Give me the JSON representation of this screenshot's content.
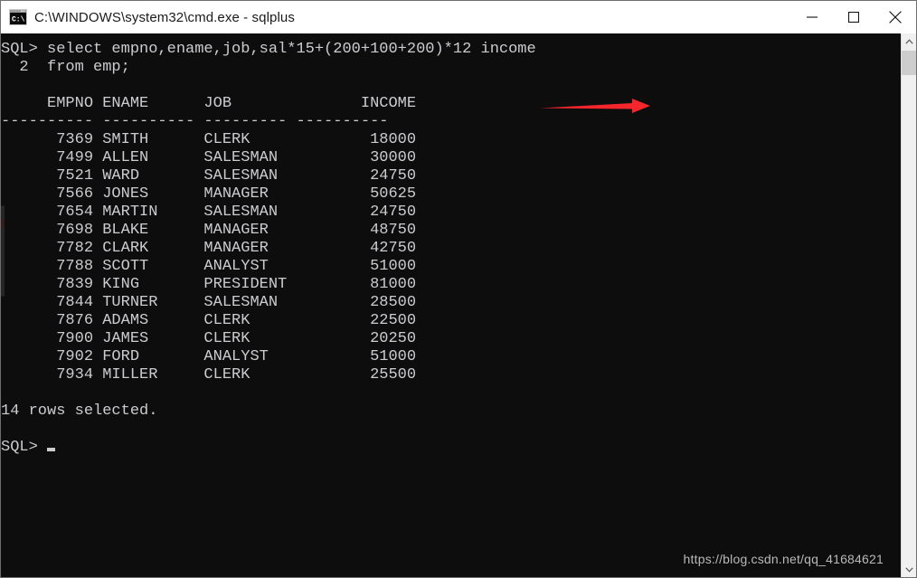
{
  "window": {
    "title": "C:\\WINDOWS\\system32\\cmd.exe - sqlplus",
    "icon": "cmd-console-icon",
    "background_color": "#0d0d0d",
    "text_color": "#ccccd0",
    "titlebar_color": "#ffffff",
    "controls": {
      "minimize_label": "Minimize",
      "maximize_label": "Maximize",
      "close_label": "Close"
    }
  },
  "terminal": {
    "prompt": "SQL>",
    "continuation_prompt": "  2",
    "query_line_1": "SQL> select empno,ename,job,sal*15+(200+100+200)*12 income",
    "query_line_2": "  2  from emp;",
    "header_line": "     EMPNO ENAME      JOB              INCOME",
    "separator_line": "---------- ---------- --------- ----------",
    "rows_text": [
      "      7369 SMITH      CLERK             18000",
      "      7499 ALLEN      SALESMAN          30000",
      "      7521 WARD       SALESMAN          24750",
      "      7566 JONES      MANAGER           50625",
      "      7654 MARTIN     SALESMAN          24750",
      "      7698 BLAKE      MANAGER           48750",
      "      7782 CLARK      MANAGER           42750",
      "      7788 SCOTT      ANALYST           51000",
      "      7839 KING       PRESIDENT         81000",
      "      7844 TURNER     SALESMAN          28500",
      "      7876 ADAMS      CLERK             22500",
      "      7900 JAMES      CLERK             20250",
      "      7902 FORD       ANALYST           51000",
      "      7934 MILLER     CLERK             25500"
    ],
    "status_line": "14 rows selected.",
    "final_prompt": "SQL>",
    "cursor": "block-cursor"
  },
  "result_table": {
    "columns": [
      "EMPNO",
      "ENAME",
      "JOB",
      "INCOME"
    ],
    "rows": [
      {
        "EMPNO": "7369",
        "ENAME": "SMITH",
        "JOB": "CLERK",
        "INCOME": "18000"
      },
      {
        "EMPNO": "7499",
        "ENAME": "ALLEN",
        "JOB": "SALESMAN",
        "INCOME": "30000"
      },
      {
        "EMPNO": "7521",
        "ENAME": "WARD",
        "JOB": "SALESMAN",
        "INCOME": "24750"
      },
      {
        "EMPNO": "7566",
        "ENAME": "JONES",
        "JOB": "MANAGER",
        "INCOME": "50625"
      },
      {
        "EMPNO": "7654",
        "ENAME": "MARTIN",
        "JOB": "SALESMAN",
        "INCOME": "24750"
      },
      {
        "EMPNO": "7698",
        "ENAME": "BLAKE",
        "JOB": "MANAGER",
        "INCOME": "48750"
      },
      {
        "EMPNO": "7782",
        "ENAME": "CLARK",
        "JOB": "MANAGER",
        "INCOME": "42750"
      },
      {
        "EMPNO": "7788",
        "ENAME": "SCOTT",
        "JOB": "ANALYST",
        "INCOME": "51000"
      },
      {
        "EMPNO": "7839",
        "ENAME": "KING",
        "JOB": "PRESIDENT",
        "INCOME": "81000"
      },
      {
        "EMPNO": "7844",
        "ENAME": "TURNER",
        "JOB": "SALESMAN",
        "INCOME": "28500"
      },
      {
        "EMPNO": "7876",
        "ENAME": "ADAMS",
        "JOB": "CLERK",
        "INCOME": "22500"
      },
      {
        "EMPNO": "7900",
        "ENAME": "JAMES",
        "JOB": "CLERK",
        "INCOME": "20250"
      },
      {
        "EMPNO": "7902",
        "ENAME": "FORD",
        "JOB": "ANALYST",
        "INCOME": "51000"
      },
      {
        "EMPNO": "7934",
        "ENAME": "MILLER",
        "JOB": "CLERK",
        "INCOME": "25500"
      }
    ],
    "row_count": 14
  },
  "annotation": {
    "type": "red-arrow",
    "color": "#f4262c",
    "direction": "right"
  },
  "watermark": {
    "text": "https://blog.csdn.net/qq_41684621",
    "color": "#b9b9b9"
  },
  "scrollbar": {
    "up_arrow": "chevron-up-icon",
    "down_arrow": "chevron-down-icon",
    "thumb": "scrollbar-thumb"
  }
}
